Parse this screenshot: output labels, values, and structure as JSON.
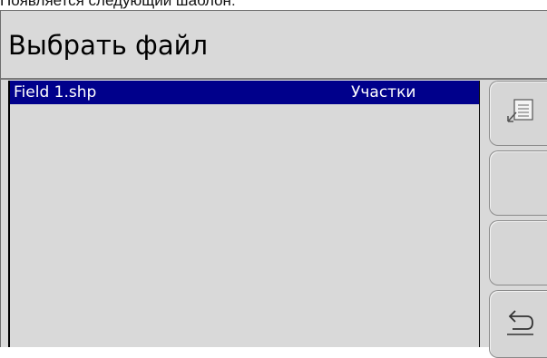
{
  "caption": "Появляется следующий шаблон:",
  "title": "Выбрать файл",
  "files": [
    {
      "name": "Field 1.shp",
      "type": "Участки",
      "selected": true
    }
  ],
  "softkeys": [
    {
      "icon": "import-file-icon"
    },
    {
      "icon": ""
    },
    {
      "icon": ""
    },
    {
      "icon": "back-arrow-icon"
    }
  ],
  "colors": {
    "background": "#d9d9d9",
    "selection": "#00008b",
    "selection_text": "#ffffff"
  }
}
